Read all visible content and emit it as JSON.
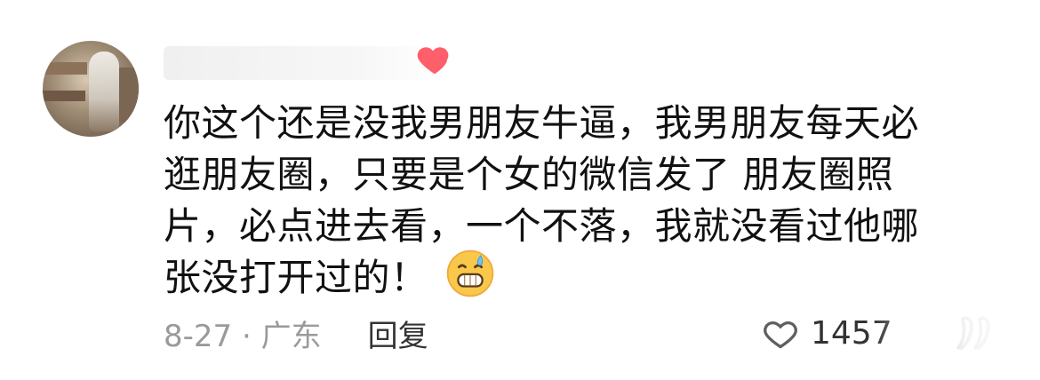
{
  "comment": {
    "text_lines": [
      "你这个还是没我男朋友牛逼，我男朋友每天必",
      "逛朋友圈，只要是个女的微信发了 朋友圈照",
      "片，必点进去看，一个不落，我就没看过他哪",
      "张没打开过的！"
    ],
    "meta": {
      "date_location": "8-27 · 广东",
      "reply_label": "回复"
    },
    "likes": {
      "count": "1457"
    }
  },
  "icons": {
    "user_badge": "heart-icon",
    "emoji": "grinning-sweat-emoji",
    "like": "heart-outline-icon",
    "quote": "quote-icon"
  },
  "colors": {
    "text": "#111111",
    "meta": "#9a9a9a",
    "badge": "#ff5e6b",
    "like": "#333333"
  }
}
